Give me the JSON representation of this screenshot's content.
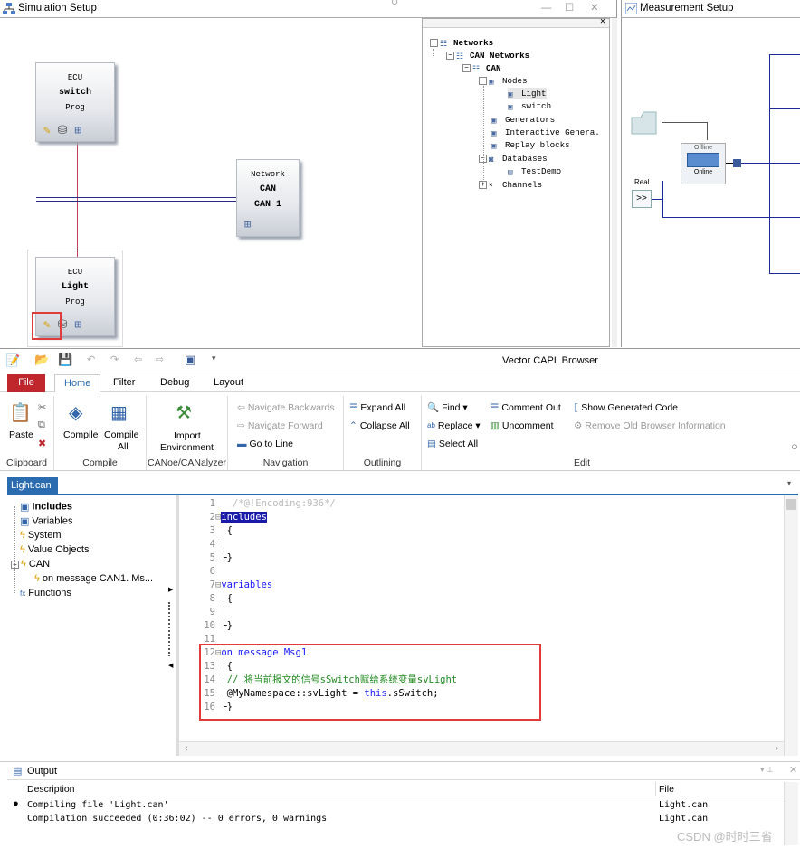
{
  "sim_window": {
    "title": "Simulation Setup",
    "ecus": [
      {
        "line1": "ECU",
        "line2": "switch",
        "line3": "Prog"
      },
      {
        "line1": "ECU",
        "line2": "Light",
        "line3": "Prog"
      }
    ],
    "network": {
      "line1": "Network",
      "line2": "CAN",
      "line3": "CAN 1"
    },
    "tree": {
      "networks": "Networks",
      "can_networks": "CAN Networks",
      "can": "CAN",
      "nodes": "Nodes",
      "light": "Light",
      "switch": "switch",
      "generators": "Generators",
      "interactive": "Interactive Genera.",
      "replay": "Replay blocks",
      "databases": "Databases",
      "testdemo": "TestDemo",
      "channels": "Channels"
    }
  },
  "meas_window": {
    "title": "Measurement Setup",
    "offline": "Offline",
    "online": "Online",
    "real": "Real",
    "expand": ">>"
  },
  "ribbon": {
    "title": "Vector CAPL Browser",
    "tabs": [
      "File",
      "Home",
      "Filter",
      "Debug",
      "Layout"
    ],
    "groups": {
      "clipboard": "Clipboard",
      "compile": "Compile",
      "canoe": "CANoe/CANalyzer",
      "navigation": "Navigation",
      "outlining": "Outlining",
      "edit": "Edit"
    },
    "buttons": {
      "paste": "Paste",
      "compile": "Compile",
      "compile_all_1": "Compile",
      "compile_all_2": "All",
      "import_1": "Import",
      "import_2": "Environment",
      "nav_back": "Navigate Backwards",
      "nav_fwd": "Navigate Forward",
      "goto_line": "Go to Line",
      "expand_all": "Expand All",
      "collapse_all": "Collapse All",
      "find": "Find",
      "replace": "Replace",
      "select_all": "Select All",
      "comment_out": "Comment Out",
      "uncomment": "Uncomment",
      "show_generated": "Show Generated Code",
      "remove_old": "Remove Old Browser Information"
    }
  },
  "editor": {
    "tab": "Light.can",
    "outline": [
      "Includes",
      "Variables",
      "System",
      "Value Objects",
      "CAN",
      "on message CAN1. Ms...",
      "Functions"
    ],
    "lines": [
      {
        "n": "1",
        "t": "/*@!Encoding:936*/"
      },
      {
        "n": "2",
        "t": "includes"
      },
      {
        "n": "3",
        "t": "{"
      },
      {
        "n": "4",
        "t": ""
      },
      {
        "n": "5",
        "t": "}"
      },
      {
        "n": "6",
        "t": ""
      },
      {
        "n": "7",
        "t": "variables"
      },
      {
        "n": "8",
        "t": "{"
      },
      {
        "n": "9",
        "t": ""
      },
      {
        "n": "10",
        "t": "}"
      },
      {
        "n": "11",
        "t": ""
      },
      {
        "n": "12",
        "t": "on message Msg1"
      },
      {
        "n": "13",
        "t": "{"
      },
      {
        "n": "14",
        "t": "// 将当前报文的信号sSwitch赋给系统变量svLight"
      },
      {
        "n": "15",
        "t": "@MyNamespace::svLight = this.sSwitch;"
      },
      {
        "n": "16",
        "t": "}"
      }
    ]
  },
  "output": {
    "title": "Output",
    "col_desc": "Description",
    "col_file": "File",
    "rows": [
      {
        "desc": "Compiling file 'Light.can'",
        "file": "Light.can"
      },
      {
        "desc": "Compilation succeeded (0:36:02) -- 0 errors, 0 warnings",
        "file": "Light.can"
      }
    ]
  },
  "watermark": "CSDN @时时三省",
  "colors": {
    "highlight_box": "#e03a3a",
    "keyword": "#1a1aff",
    "comment": "#1f8a1f",
    "tab_active": "#2b6cb0",
    "file_tab": "#c0272d"
  }
}
